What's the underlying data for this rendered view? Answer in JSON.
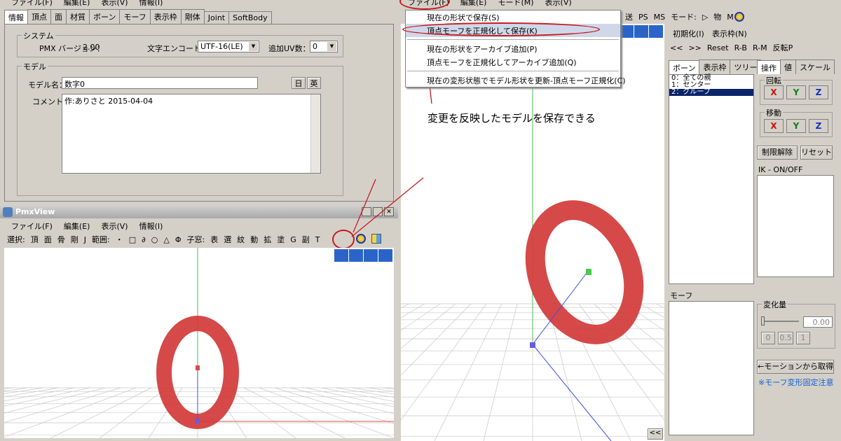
{
  "left_top": {
    "menu": [
      "ファイル(F)",
      "編集(E)",
      "表示(V)",
      "情報(I)"
    ],
    "tabs": [
      "情報",
      "頂点",
      "面",
      "材質",
      "ボーン",
      "モーフ",
      "表示枠",
      "剛体",
      "Joint",
      "SoftBody"
    ],
    "system": {
      "legend": "システム",
      "pmx_version_label": "PMX バージョン：",
      "pmx_version": "2.00",
      "encoding_label": "文字エンコード：",
      "encoding_value": "UTF-16(LE)",
      "uv_label": "追加UV数：",
      "uv_value": "0"
    },
    "model": {
      "legend": "モデル",
      "name_label": "モデル名：",
      "name_value": "数字0",
      "btn_jp": "日",
      "btn_en": "英",
      "comment_label": "コメント：",
      "comment_value": "作:ありさと 2015-04-04"
    }
  },
  "pmxview": {
    "title": "PmxView",
    "menu": [
      "ファイル(F)",
      "編集(E)",
      "表示(V)",
      "情報(I)"
    ],
    "toolbar": [
      "選択:",
      "頂",
      "面",
      "骨",
      "剛",
      "J",
      "範囲:",
      "・",
      "□",
      "∂",
      "○",
      "△",
      "Φ",
      "子窓:",
      "表",
      "選",
      "紋",
      "動",
      "拡",
      "塗",
      "G",
      "副",
      "T"
    ]
  },
  "right": {
    "menu": [
      "ファイル(F)",
      "編集(E)",
      "モード(M)",
      "表示(V)"
    ],
    "toolbar": [
      "送",
      "PS",
      "MS",
      "モード:",
      "▷",
      "物",
      "M"
    ],
    "dropdown": [
      "現在の形状で保存(S)",
      "頂点モーフを正規化して保存(K)",
      "現在の形状をアーカイブ追加(P)",
      "頂点モーフを正規化してアーカイブ追加(Q)",
      "現在の変形状態でモデル形状を更新-頂点モーフ正規化(C)"
    ],
    "annotation": "変更を反映したモデルを保存できる",
    "panel": {
      "init": "初期化(I)",
      "frame": "表示枠(N)",
      "nav": [
        "<<",
        ">>",
        "Reset",
        "R-B",
        "R-M",
        "反転P"
      ],
      "tabs_left": [
        "ボーン",
        "表示枠",
        "ツリー"
      ],
      "bone_list": [
        "0：全ての親",
        "1：センター",
        "2：グループ"
      ],
      "tabs_right": [
        "操作",
        "値",
        "スケール"
      ],
      "rotate": "回転",
      "move": "移動",
      "x": "X",
      "y": "Y",
      "z": "Z",
      "limit_release": "制限解除",
      "reset": "リセット",
      "ik": "IK - ON/OFF",
      "morph": "モーフ",
      "change": "変化量",
      "change_value": "0.00",
      "presets": [
        "0",
        "0.5",
        "1"
      ],
      "from_motion": "←モーションから取得",
      "note": "※モーフ変形固定注意",
      "collapse": "<<"
    }
  },
  "colors": {
    "highlight_red": "#c8191e",
    "model_red": "#d23a3a",
    "select_blue": "#0a246a"
  }
}
